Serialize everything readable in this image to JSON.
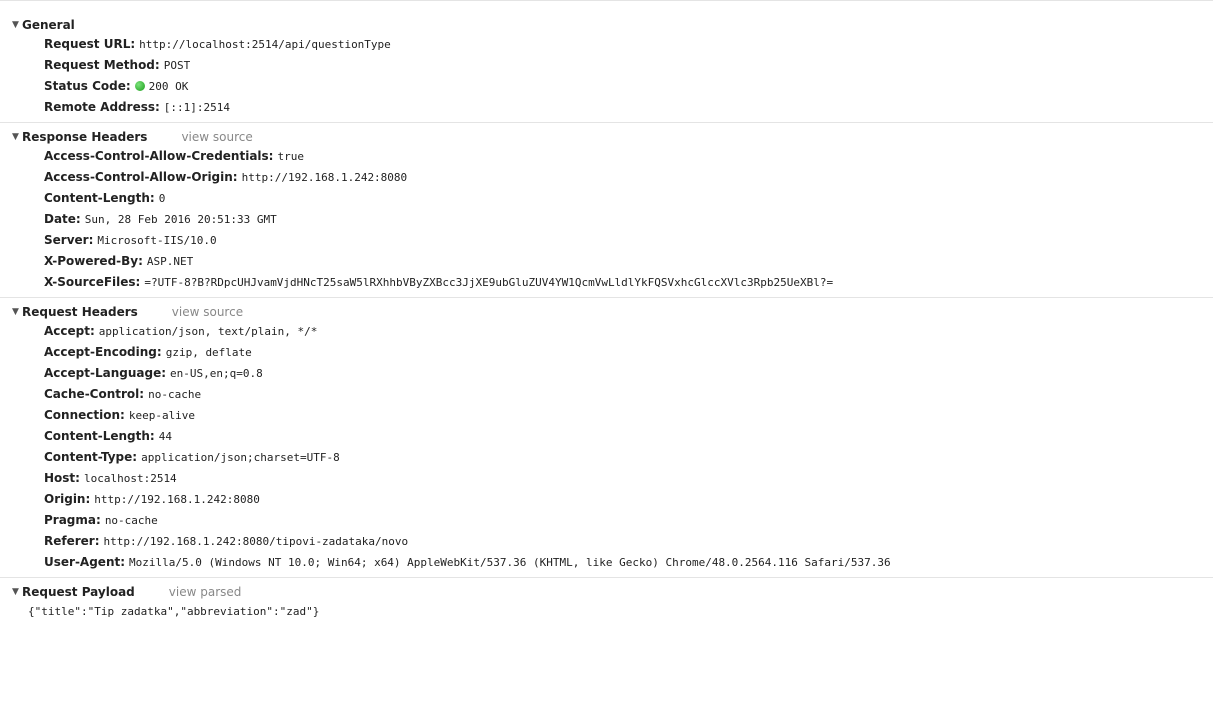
{
  "general": {
    "title": "General",
    "rows": [
      {
        "key": "Request URL:",
        "value": "http://localhost:2514/api/questionType"
      },
      {
        "key": "Request Method:",
        "value": "POST"
      },
      {
        "key": "Status Code:",
        "value": "200 OK"
      },
      {
        "key": "Remote Address:",
        "value": "[::1]:2514"
      }
    ],
    "status_color": "#22aa22"
  },
  "response_headers": {
    "title": "Response Headers",
    "view_link": "view source",
    "rows": [
      {
        "key": "Access-Control-Allow-Credentials:",
        "value": "true"
      },
      {
        "key": "Access-Control-Allow-Origin:",
        "value": "http://192.168.1.242:8080"
      },
      {
        "key": "Content-Length:",
        "value": "0"
      },
      {
        "key": "Date:",
        "value": "Sun, 28 Feb 2016 20:51:33 GMT"
      },
      {
        "key": "Server:",
        "value": "Microsoft-IIS/10.0"
      },
      {
        "key": "X-Powered-By:",
        "value": "ASP.NET"
      },
      {
        "key": "X-SourceFiles:",
        "value": "=?UTF-8?B?RDpcUHJvamVjdHNcT25saW5lRXhhbVByZXBcc3JjXE9ubGluZUV4YW1QcmVwLldlYkFQSVxhcGlccXVlc3Rpb25UeXBl?="
      }
    ]
  },
  "request_headers": {
    "title": "Request Headers",
    "view_link": "view source",
    "rows": [
      {
        "key": "Accept:",
        "value": "application/json, text/plain, */*"
      },
      {
        "key": "Accept-Encoding:",
        "value": "gzip, deflate"
      },
      {
        "key": "Accept-Language:",
        "value": "en-US,en;q=0.8"
      },
      {
        "key": "Cache-Control:",
        "value": "no-cache"
      },
      {
        "key": "Connection:",
        "value": "keep-alive"
      },
      {
        "key": "Content-Length:",
        "value": "44"
      },
      {
        "key": "Content-Type:",
        "value": "application/json;charset=UTF-8"
      },
      {
        "key": "Host:",
        "value": "localhost:2514"
      },
      {
        "key": "Origin:",
        "value": "http://192.168.1.242:8080"
      },
      {
        "key": "Pragma:",
        "value": "no-cache"
      },
      {
        "key": "Referer:",
        "value": "http://192.168.1.242:8080/tipovi-zadataka/novo"
      },
      {
        "key": "User-Agent:",
        "value": "Mozilla/5.0 (Windows NT 10.0; Win64; x64) AppleWebKit/537.36 (KHTML, like Gecko) Chrome/48.0.2564.116 Safari/537.36"
      }
    ]
  },
  "request_payload": {
    "title": "Request Payload",
    "view_link": "view parsed",
    "body": "{\"title\":\"Tip zadatka\",\"abbreviation\":\"zad\"}"
  },
  "icons": {
    "expanded": "▼"
  }
}
